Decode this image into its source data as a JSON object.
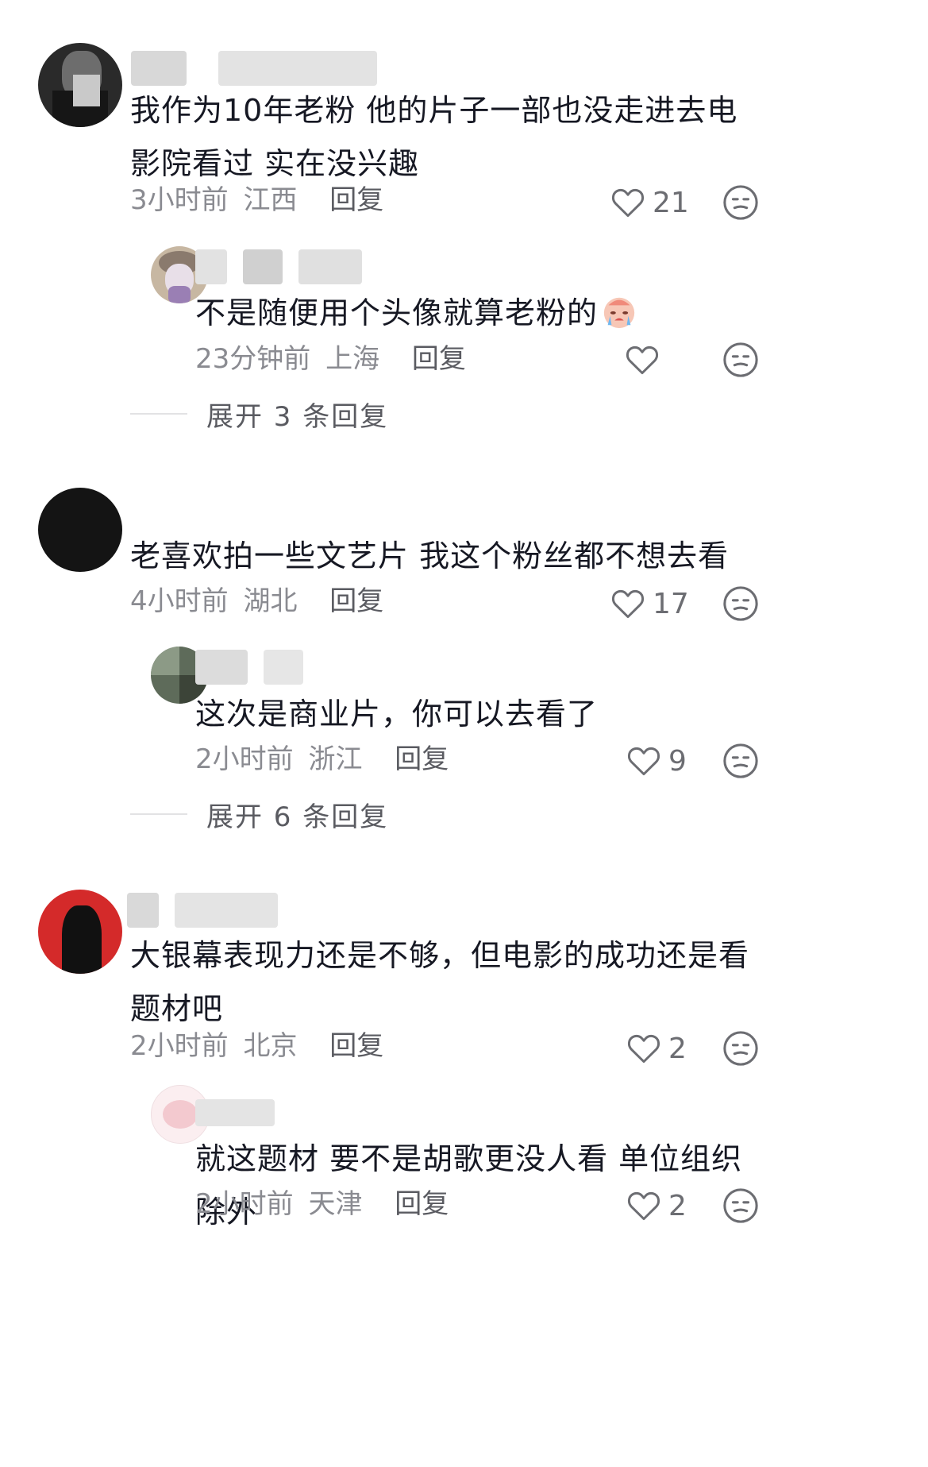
{
  "threads": [
    {
      "comment": {
        "text": "我作为10年老粉 他的片子一部也没走进去电影院看过 实在没兴趣",
        "time": "3小时前",
        "location": "江西",
        "reply_label": "回复",
        "likes": "21",
        "avatar_icon": "user-avatar-icon"
      },
      "replies": [
        {
          "text": "不是随便用个头像就算老粉的",
          "time": "23分钟前",
          "location": "上海",
          "reply_label": "回复",
          "likes": "",
          "emoji_icon": "crying-face-icon"
        }
      ],
      "expand_label": "展开 3 条回复"
    },
    {
      "comment": {
        "text": "老喜欢拍一些文艺片 我这个粉丝都不想去看",
        "time": "4小时前",
        "location": "湖北",
        "reply_label": "回复",
        "likes": "17"
      },
      "replies": [
        {
          "text": "这次是商业片，你可以去看了",
          "time": "2小时前",
          "location": "浙江",
          "reply_label": "回复",
          "likes": "9"
        }
      ],
      "expand_label": "展开 6 条回复"
    },
    {
      "comment": {
        "text": "大银幕表现力还是不够，但电影的成功还是看题材吧",
        "time": "2小时前",
        "location": "北京",
        "reply_label": "回复",
        "likes": "2"
      },
      "replies": [
        {
          "text": "就这题材 要不是胡歌更没人看 单位组织除外",
          "time": "2小时前",
          "location": "天津",
          "reply_label": "回复",
          "likes": "2"
        }
      ]
    }
  ],
  "colors": {
    "text": "#161823",
    "meta": "#8a8b91",
    "reply": "#5a5b61",
    "icon": "#6c6d72"
  }
}
